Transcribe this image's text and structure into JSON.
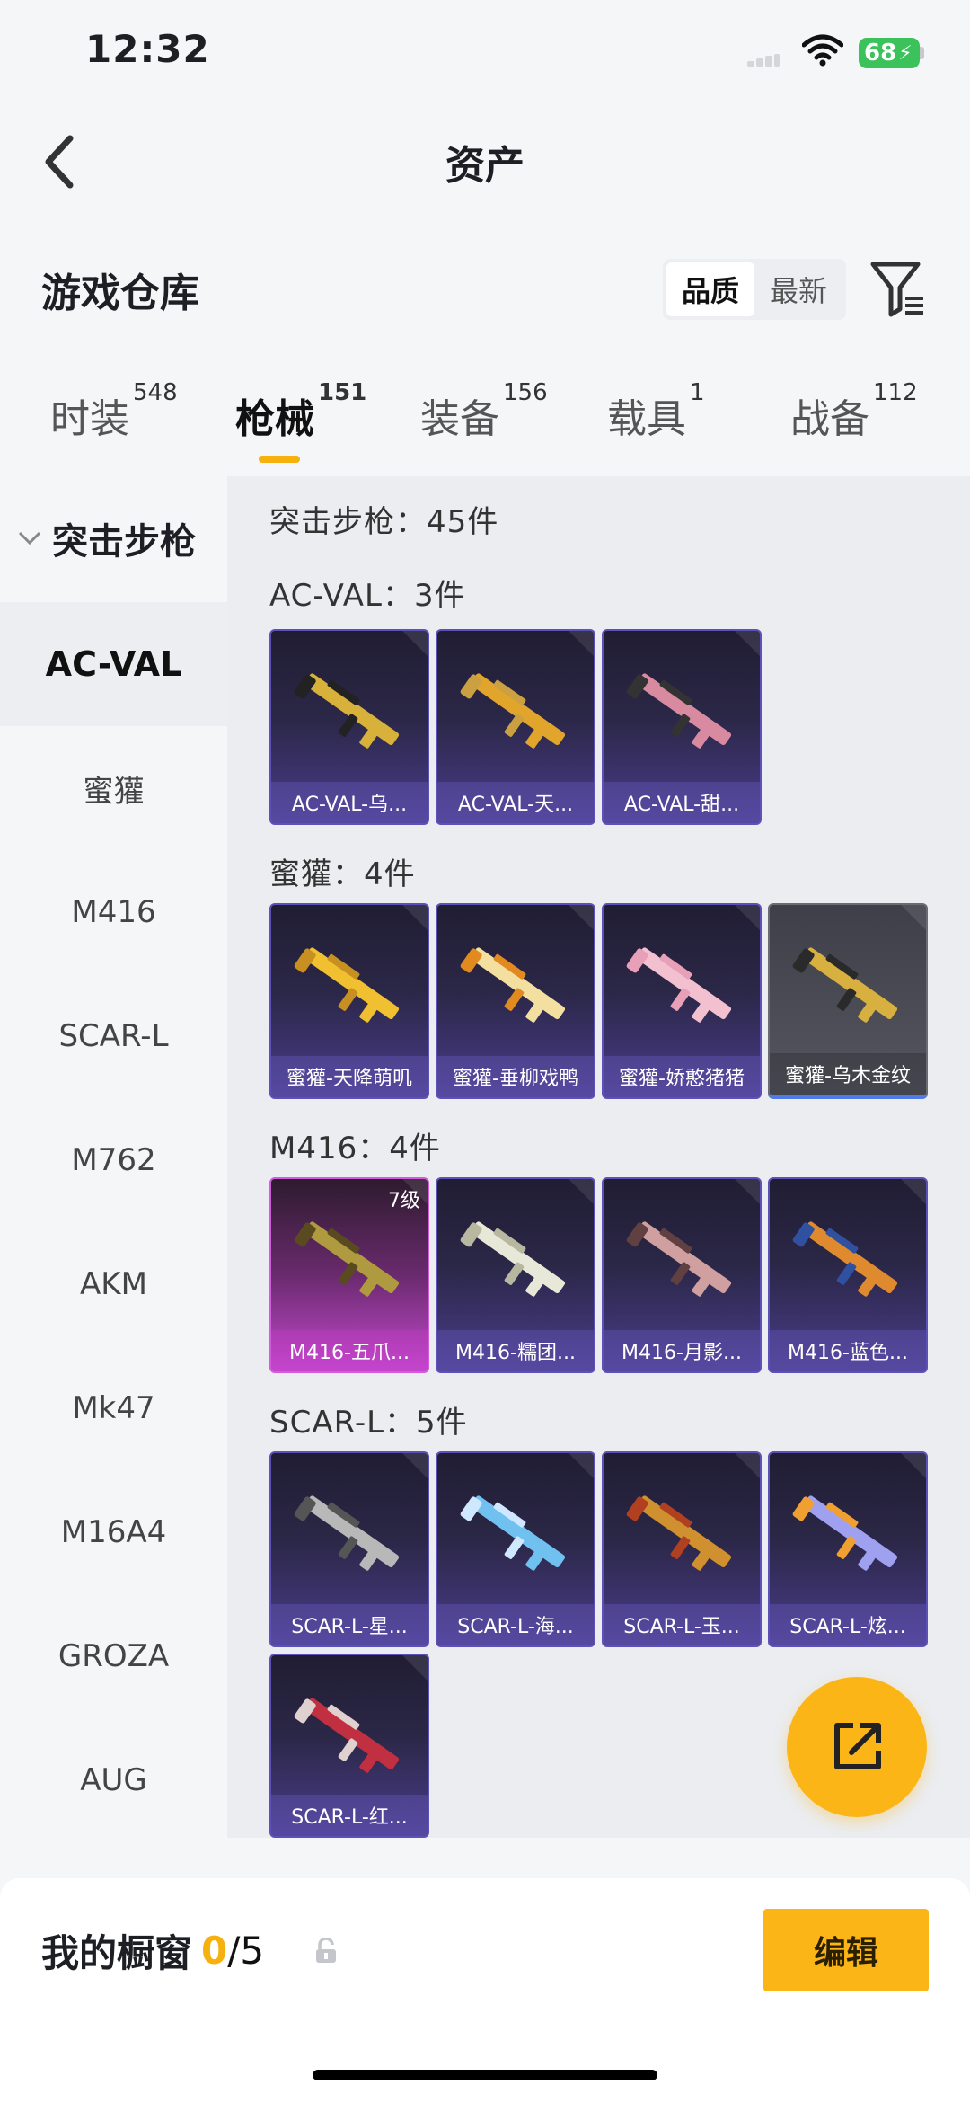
{
  "status": {
    "time": "12:32",
    "battery": "68"
  },
  "nav": {
    "title": "资产"
  },
  "warehouse": {
    "title": "游戏仓库",
    "sort_options": [
      "品质",
      "最新"
    ]
  },
  "tabs": [
    {
      "label": "时装",
      "count": "548"
    },
    {
      "label": "枪械",
      "count": "151"
    },
    {
      "label": "装备",
      "count": "156"
    },
    {
      "label": "载具",
      "count": "1"
    },
    {
      "label": "战备",
      "count": "112"
    }
  ],
  "sidebar": {
    "category": "突击步枪",
    "items": [
      "AC-VAL",
      "蜜獾",
      "M416",
      "SCAR-L",
      "M762",
      "AKM",
      "Mk47",
      "M16A4",
      "GROZA",
      "AUG"
    ]
  },
  "content": {
    "summary": "突击步枪：45件",
    "groups": [
      {
        "title": "AC-VAL：3件",
        "items": [
          "AC-VAL-乌...",
          "AC-VAL-天...",
          "AC-VAL-甜..."
        ]
      },
      {
        "title": "蜜獾：4件",
        "items": [
          "蜜獾-天降萌叽",
          "蜜獾-垂柳戏鸭",
          "蜜獾-娇憨猪猪",
          "蜜獾-乌木金纹"
        ]
      },
      {
        "title": "M416：4件",
        "items": [
          "M416-五爪...",
          "M416-糯团...",
          "M416-月影...",
          "M416-蓝色..."
        ],
        "level": "7级"
      },
      {
        "title": "SCAR-L：5件",
        "items": [
          "SCAR-L-星...",
          "SCAR-L-海...",
          "SCAR-L-玉...",
          "SCAR-L-炫...",
          "SCAR-L-红..."
        ]
      }
    ]
  },
  "showcase": {
    "title": "我的橱窗",
    "count": "0",
    "total": "/5",
    "edit_label": "编辑"
  },
  "colors": {
    "accent": "#fbb516",
    "card_purple": "#4a3d8c",
    "card_pink": "#c44ad0",
    "card_grey": "#55565f"
  }
}
